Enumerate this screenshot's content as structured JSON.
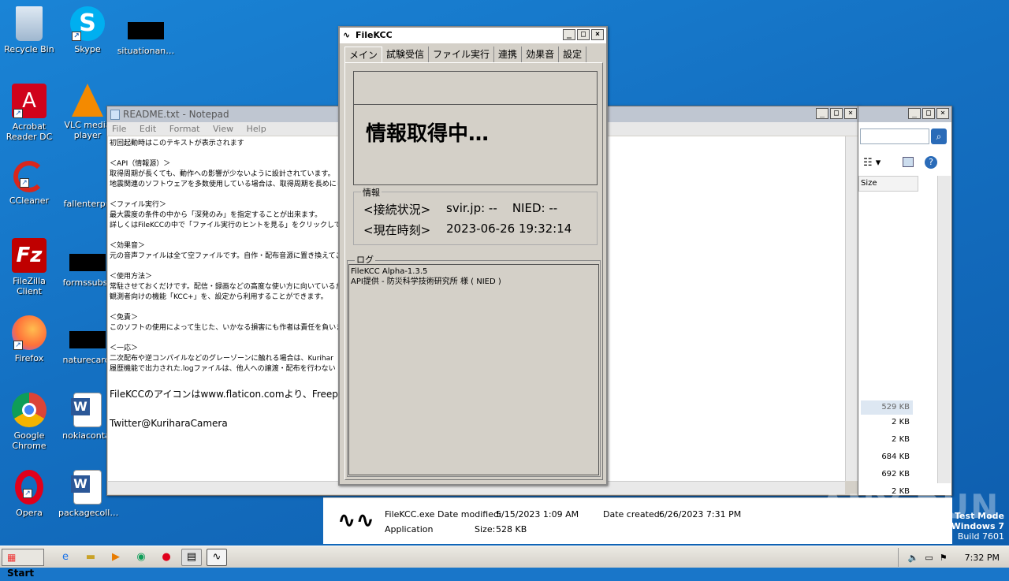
{
  "desktop_icons": [
    {
      "label": "Recycle Bin",
      "icon": "recycle-bin-icon"
    },
    {
      "label": "Skype",
      "icon": "skype-icon"
    },
    {
      "label": "situationan…",
      "icon": "redacted-icon"
    },
    {
      "label": "Acrobat Reader DC",
      "icon": "acrobat-icon"
    },
    {
      "label": "VLC media player",
      "icon": "vlc-icon"
    },
    {
      "label": "CCleaner",
      "icon": "ccleaner-icon"
    },
    {
      "label": "fallenterpri",
      "icon": "word-doc-icon"
    },
    {
      "label": "FileZilla Client",
      "icon": "filezilla-icon"
    },
    {
      "label": "formssubsc",
      "icon": "redacted-icon"
    },
    {
      "label": "Firefox",
      "icon": "firefox-icon"
    },
    {
      "label": "naturecarol",
      "icon": "redacted-icon"
    },
    {
      "label": "Google Chrome",
      "icon": "chrome-icon"
    },
    {
      "label": "nokiacontai",
      "icon": "word-doc-icon"
    },
    {
      "label": "Opera",
      "icon": "opera-icon"
    },
    {
      "label": "packagecoll…",
      "icon": "word-doc-icon"
    }
  ],
  "notepad": {
    "title": "README.txt - Notepad",
    "menu": [
      "File",
      "Edit",
      "Format",
      "View",
      "Help"
    ],
    "lines": [
      "初回起動時はこのテキストが表示されます",
      "",
      "＜API（情報源）＞",
      "取得周期が長くても、動作への影響が少ないように設計されています。",
      "地震関連のソフトウェアを多数使用している場合は、取得周期を長めにし",
      "",
      "＜ファイル実行＞",
      "最大震度の条件の中から「深発のみ」を指定することが出来ます。",
      "詳しくはFileKCCの中で「ファイル実行のヒントを見る」をクリックしてくださ",
      "",
      "＜効果音＞",
      "元の音声ファイルは全て空ファイルです。自作・配布音源に置き換えてご利",
      "",
      "＜使用方法＞",
      "常駐させておくだけです。配信・録画などの高度な使い方に向いているかもし",
      "観測者向けの機能「KCC+」を、設定から利用することができます。",
      "",
      "＜免責＞",
      "このソフトの使用によって生じた、いかなる損害にも作者は責任を負いませ",
      "",
      "＜一応＞",
      "二次配布や逆コンパイルなどのグレーゾーンに触れる場合は、Kurihar",
      "履歴機能で出力された.logファイルは、他人への譲渡・配布を行わない",
      "",
      "FileKCCのアイコンはwww.flaticon.comより、Freep",
      "",
      "Twitter@KuriharaCamera"
    ]
  },
  "filekcc": {
    "title": "FileKCC",
    "tabs": [
      "メイン",
      "試験受信",
      "ファイル実行",
      "連携",
      "効果音",
      "設定"
    ],
    "status_text": "情報取得中…",
    "info_legend": "情報",
    "connection_label": "<接続状況>",
    "connection_value": "svir.jp: --    NIED: --",
    "time_label": "<現在時刻>",
    "time_value": "2023-06-26 19:32:14",
    "log_legend": "ログ",
    "log_lines": [
      "FileKCC Alpha-1.3.5",
      "API提供 - 防災科学技術研究所 様 ( NIED )"
    ]
  },
  "explorer_sizes": [
    "529 KB",
    "2 KB",
    "2 KB",
    "684 KB",
    "692 KB",
    "2 KB"
  ],
  "explorer_size_header": "Size",
  "details": {
    "name": "FileKCC.exe",
    "type": "Application",
    "modified_label": "Date modified:",
    "modified_value": "5/15/2023 1:09 AM",
    "size_label": "Size:",
    "size_value": "528 KB",
    "created_label": "Date created:",
    "created_value": "6/26/2023 7:31 PM"
  },
  "taskbar": {
    "start": "Start",
    "clock": "7:32 PM"
  },
  "watermark": {
    "line1": "Test Mode",
    "line2": "Windows 7",
    "line3": "Build 7601",
    "brand": "ANY RUN"
  }
}
